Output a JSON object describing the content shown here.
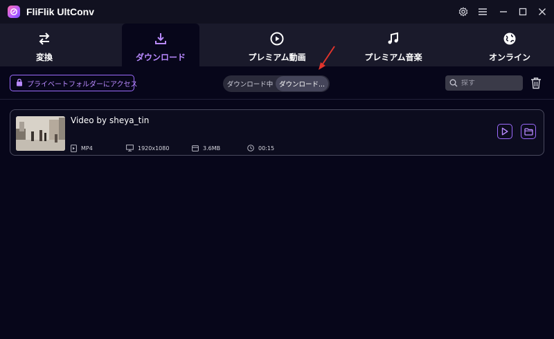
{
  "app": {
    "title": "FliFlik UltConv"
  },
  "window_controls": [
    "gear-icon",
    "menu-icon",
    "minimize-icon",
    "maximize-icon",
    "close-icon"
  ],
  "tabs": [
    {
      "label": "変換",
      "icon": "swap-icon",
      "active": false
    },
    {
      "label": "ダウンロード",
      "icon": "download-icon",
      "active": true
    },
    {
      "label": "プレミアム動画",
      "icon": "play-circle-icon",
      "active": false
    },
    {
      "label": "プレミアム音楽",
      "icon": "music-note-icon",
      "active": false
    },
    {
      "label": "オンライン",
      "icon": "globe-icon",
      "active": false
    }
  ],
  "toolbar": {
    "private_folder_label": "プライベートフォルダーにアクセス",
    "segment": [
      {
        "label": "ダウンロード中",
        "selected": false
      },
      {
        "label": "ダウンロード...",
        "selected": true
      }
    ],
    "search_placeholder": "探す"
  },
  "downloads": [
    {
      "title": "Video by sheya_tin",
      "format": "MP4",
      "resolution": "1920x1080",
      "size": "3.6MB",
      "duration": "00:15"
    }
  ],
  "colors": {
    "accent": "#9d6bff",
    "accent_text": "#b98aff",
    "background": "#07061a",
    "tabbar": "#1a1a2b",
    "annotation_arrow": "#e0342c"
  }
}
